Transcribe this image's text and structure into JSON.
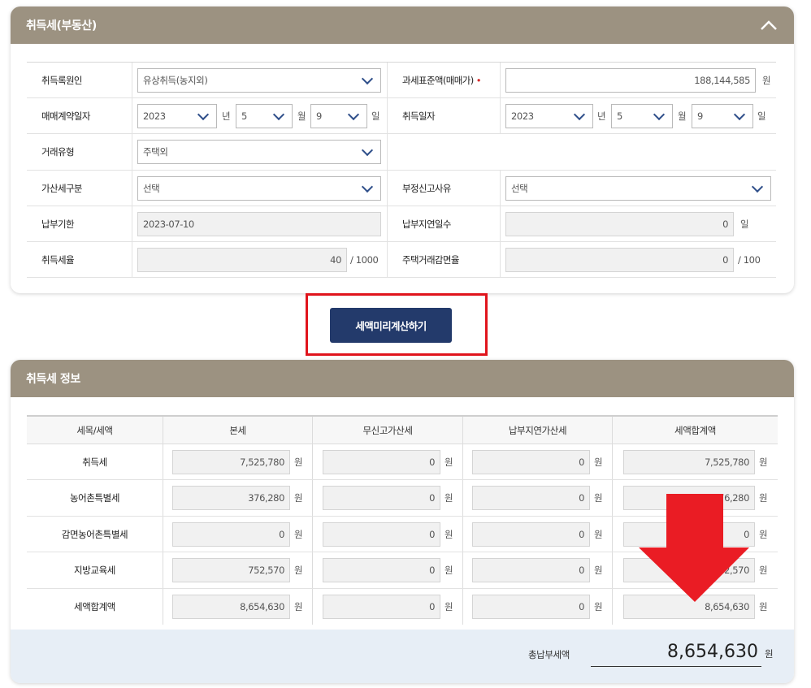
{
  "form_panel": {
    "title": "취득세(부동산)",
    "fields": {
      "reg_cause": {
        "label": "취득록원인",
        "value": "유상취득(농지외)"
      },
      "tax_base": {
        "label": "과세표준액(매매가)",
        "required_mark": "•",
        "value": "188,144,585",
        "unit": "원"
      },
      "contract_date": {
        "label": "매매계약일자",
        "year": "2023",
        "year_unit": "년",
        "month": "5",
        "month_unit": "월",
        "day": "9",
        "day_unit": "일"
      },
      "acq_date": {
        "label": "취득일자",
        "year": "2023",
        "year_unit": "년",
        "month": "5",
        "month_unit": "월",
        "day": "9",
        "day_unit": "일"
      },
      "trade_type": {
        "label": "거래유형",
        "value": "주택외"
      },
      "surcharge": {
        "label": "가산세구분",
        "value": "선택"
      },
      "fraud_reason": {
        "label": "부정신고사유",
        "value": "선택"
      },
      "due_date": {
        "label": "납부기한",
        "value": "2023-07-10"
      },
      "late_days": {
        "label": "납부지연일수",
        "value": "0",
        "unit": "일"
      },
      "tax_rate": {
        "label": "취득세율",
        "value": "40",
        "unit": "/ 1000"
      },
      "housing_reduction": {
        "label": "주택거래감면율",
        "value": "0",
        "unit": "/ 100"
      }
    }
  },
  "calc_button": {
    "label": "세액미리계산하기"
  },
  "info_panel": {
    "title": "취득세 정보",
    "columns": [
      "세목/세액",
      "본세",
      "무신고가산세",
      "납부지연가산세",
      "세액합계액"
    ],
    "unit": "원",
    "rows": [
      {
        "label": "취득세",
        "values": [
          "7,525,780",
          "0",
          "0",
          "7,525,780"
        ]
      },
      {
        "label": "농어촌특별세",
        "values": [
          "376,280",
          "0",
          "0",
          "376,280"
        ]
      },
      {
        "label": "감면농어촌특별세",
        "values": [
          "0",
          "0",
          "0",
          "0"
        ]
      },
      {
        "label": "지방교육세",
        "values": [
          "752,570",
          "0",
          "0",
          "752,570"
        ]
      },
      {
        "label": "세액합계액",
        "values": [
          "8,654,630",
          "0",
          "0",
          "8,654,630"
        ]
      }
    ],
    "total": {
      "label": "총납부세액",
      "value": "8,654,630",
      "unit": "원"
    }
  },
  "colors": {
    "header_bg": "#9c9281",
    "button_bg": "#233a6b",
    "highlight": "#e0141c",
    "arrow": "#ea1c24",
    "total_bg": "#e7eef6"
  },
  "icons": {
    "collapse": "chevron-up-icon",
    "dropdown": "chevron-down-icon",
    "annotation": "red-down-arrow"
  }
}
